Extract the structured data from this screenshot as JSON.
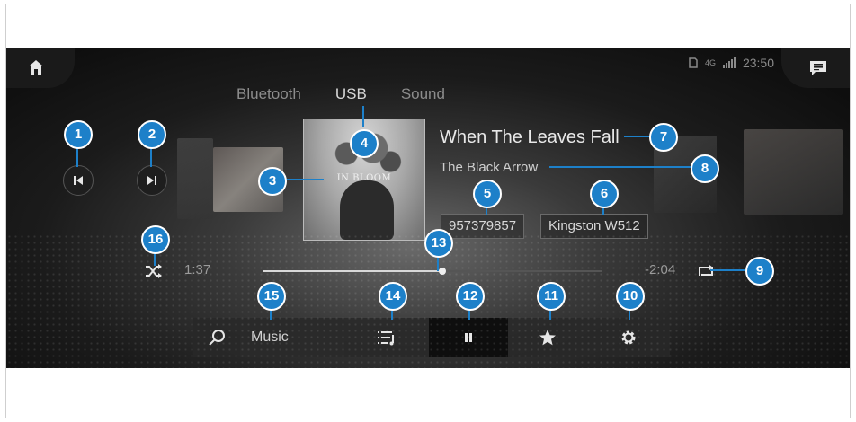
{
  "status": {
    "network": "4G",
    "time": "23:50"
  },
  "source_tabs": [
    "Bluetooth",
    "USB",
    "Sound"
  ],
  "active_source": "USB",
  "album_cover": {
    "text": "IN BLOOM"
  },
  "track": {
    "title": "When The Leaves Fall",
    "artist": "The Black Arrow",
    "album": "957379857",
    "device": "Kingston W512"
  },
  "playback": {
    "elapsed": "1:37",
    "remaining": "-2:04",
    "progress_fraction": 0.53
  },
  "bottom_bar": {
    "category": "Music"
  },
  "callouts": [
    "1",
    "2",
    "3",
    "4",
    "5",
    "6",
    "7",
    "8",
    "9",
    "10",
    "11",
    "12",
    "13",
    "14",
    "15",
    "16"
  ],
  "colors": {
    "callout": "#1d80c9",
    "background": "#111111",
    "text": "#e8e8e8"
  },
  "icons": [
    "home-icon",
    "message-icon",
    "previous-track-icon",
    "next-track-icon",
    "shuffle-icon",
    "repeat-icon",
    "search-icon",
    "playlist-icon",
    "pause-icon",
    "star-icon",
    "gear-icon"
  ]
}
